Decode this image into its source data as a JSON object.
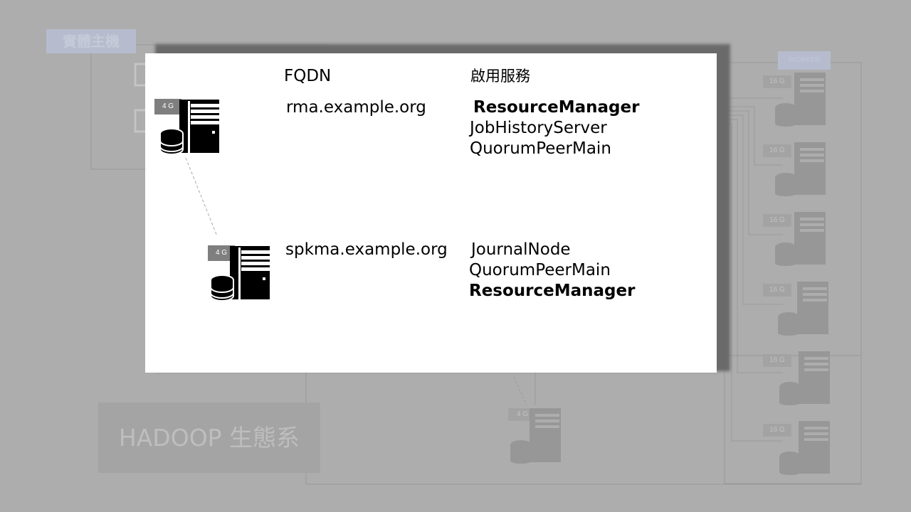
{
  "background": {
    "physical_host_label": "實體主機",
    "worker_label": "WORKER",
    "hadoop_label": "HADOOP 生態系",
    "worker_ram_labels": [
      "16 G",
      "16 G",
      "16 G",
      "16 G",
      "16 G",
      "16 G"
    ],
    "bottom_server_ram": "4 G"
  },
  "panel": {
    "headers": {
      "fqdn": "FQDN",
      "services": "啟用服務"
    },
    "hosts": [
      {
        "ram": "4 G",
        "fqdn": "rma.example.org",
        "services": [
          {
            "name": "ResourceManager",
            "bold": true
          },
          {
            "name": "JobHistoryServer",
            "bold": false
          },
          {
            "name": "QuorumPeerMain",
            "bold": false
          }
        ]
      },
      {
        "ram": "4 G",
        "fqdn": "spkma.example.org",
        "services": [
          {
            "name": "JournalNode",
            "bold": false
          },
          {
            "name": "QuorumPeerMain",
            "bold": false
          },
          {
            "name": "ResourceManager",
            "bold": true
          }
        ]
      }
    ]
  },
  "colors": {
    "background": "#adadad",
    "panel": "#ffffff",
    "ram_badge": "#7f7f7f",
    "faded_tag": "#b6bccd"
  }
}
